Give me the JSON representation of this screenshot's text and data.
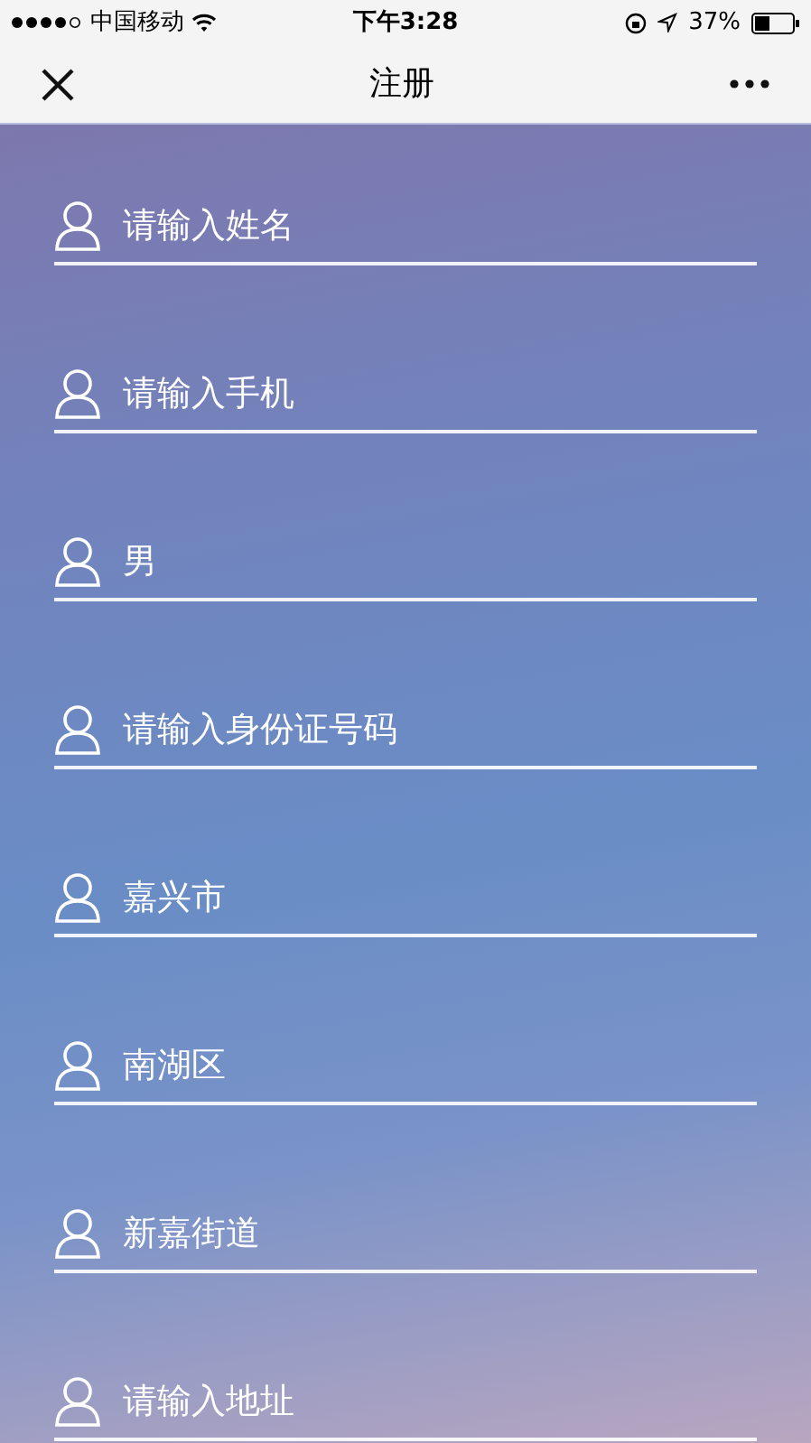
{
  "status_bar": {
    "carrier": "中国移动",
    "time": "下午3:28",
    "battery": "37%"
  },
  "nav_bar": {
    "title": "注册"
  },
  "fields": [
    {
      "placeholder": "请输入姓名"
    },
    {
      "placeholder": "请输入手机"
    },
    {
      "value": "男"
    },
    {
      "placeholder": "请输入身份证号码"
    },
    {
      "value": "嘉兴市"
    },
    {
      "value": "南湖区"
    },
    {
      "value": "新嘉街道"
    },
    {
      "placeholder": "请输入地址"
    }
  ]
}
